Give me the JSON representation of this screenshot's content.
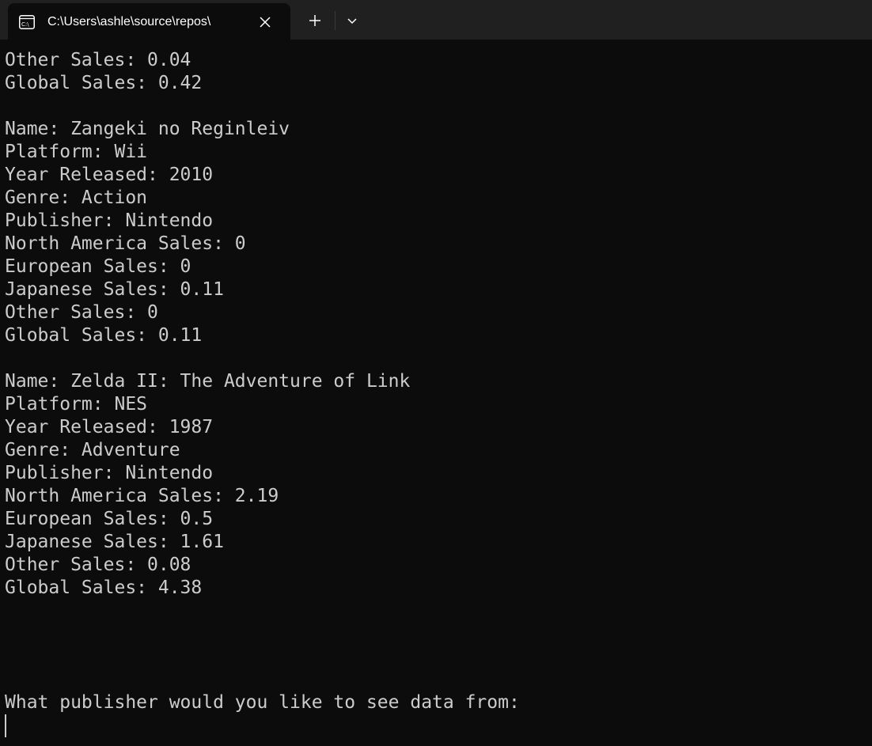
{
  "tab": {
    "title": "C:\\Users\\ashle\\source\\repos\\"
  },
  "icons": {
    "tab_icon": "console-icon",
    "close": "close-icon",
    "new_tab": "plus-icon",
    "dropdown": "chevron-down-icon"
  },
  "colors": {
    "background": "#0c0c0c",
    "tabbar": "#202020",
    "text": "#cccccc"
  },
  "console": {
    "lines": [
      "Other Sales: 0.04",
      "Global Sales: 0.42",
      "",
      "Name: Zangeki no Reginleiv",
      "Platform: Wii",
      "Year Released: 2010",
      "Genre: Action",
      "Publisher: Nintendo",
      "North America Sales: 0",
      "European Sales: 0",
      "Japanese Sales: 0.11",
      "Other Sales: 0",
      "Global Sales: 0.11",
      "",
      "Name: Zelda II: The Adventure of Link",
      "Platform: NES",
      "Year Released: 1987",
      "Genre: Adventure",
      "Publisher: Nintendo",
      "North America Sales: 2.19",
      "European Sales: 0.5",
      "Japanese Sales: 1.61",
      "Other Sales: 0.08",
      "Global Sales: 4.38",
      "",
      "",
      "",
      "",
      "What publisher would you like to see data from:"
    ]
  }
}
